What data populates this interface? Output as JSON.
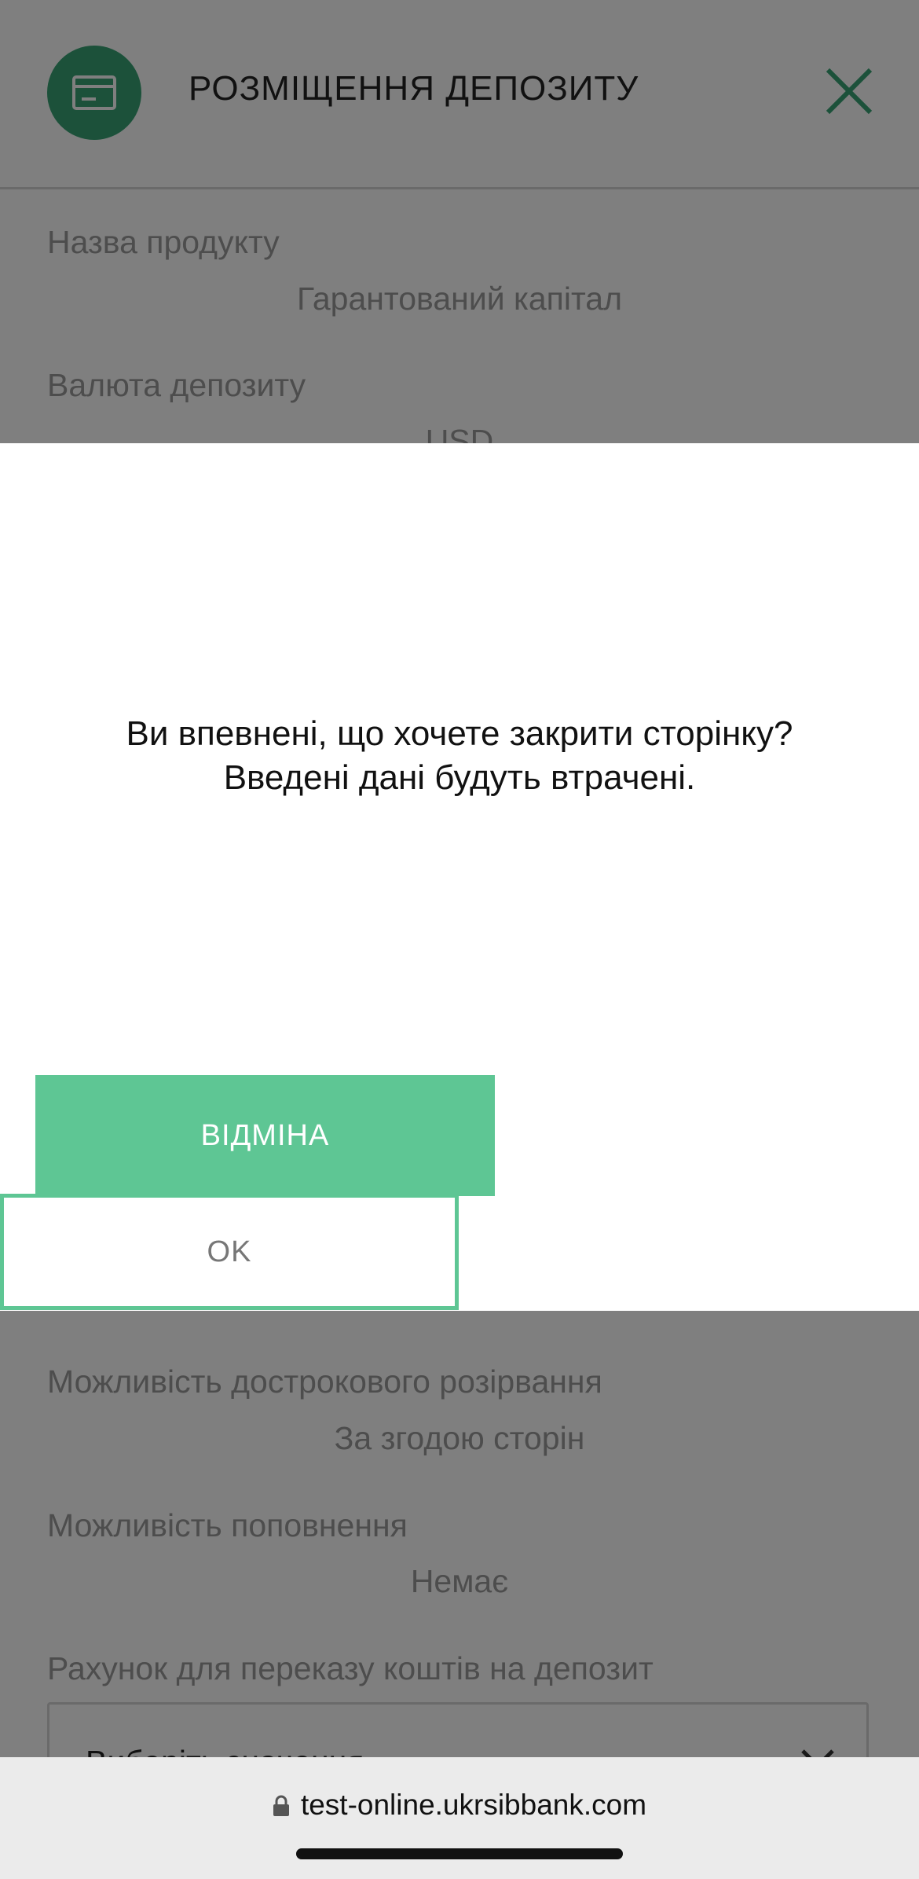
{
  "header": {
    "title": "РОЗМІЩЕННЯ ДЕПОЗИТУ",
    "icon": "card-icon",
    "close_icon": "close-icon",
    "accent_color": "#38a375"
  },
  "form": {
    "fields": [
      {
        "label": "Назва продукту",
        "value": "Гарантований капітал"
      },
      {
        "label": "Валюта депозиту",
        "value": "USD"
      },
      {
        "label": "Можливість дострокового розірвання",
        "value": "За згодою сторін"
      },
      {
        "label": "Можливість поповнення",
        "value": "Немає"
      }
    ],
    "account_label": "Рахунок для переказу коштів на депозит",
    "account_placeholder": "Виберіть значення"
  },
  "dialog": {
    "message_line1": "Ви впевнені, що хочете закрити сторінку?",
    "message_line2": "Введені дані будуть втрачені.",
    "cancel_label": "ВІДМІНА",
    "ok_label": "OK",
    "button_color": "#5ec694"
  },
  "browser": {
    "url": "test-online.ukrsibbank.com",
    "lock_icon": "lock-icon"
  }
}
